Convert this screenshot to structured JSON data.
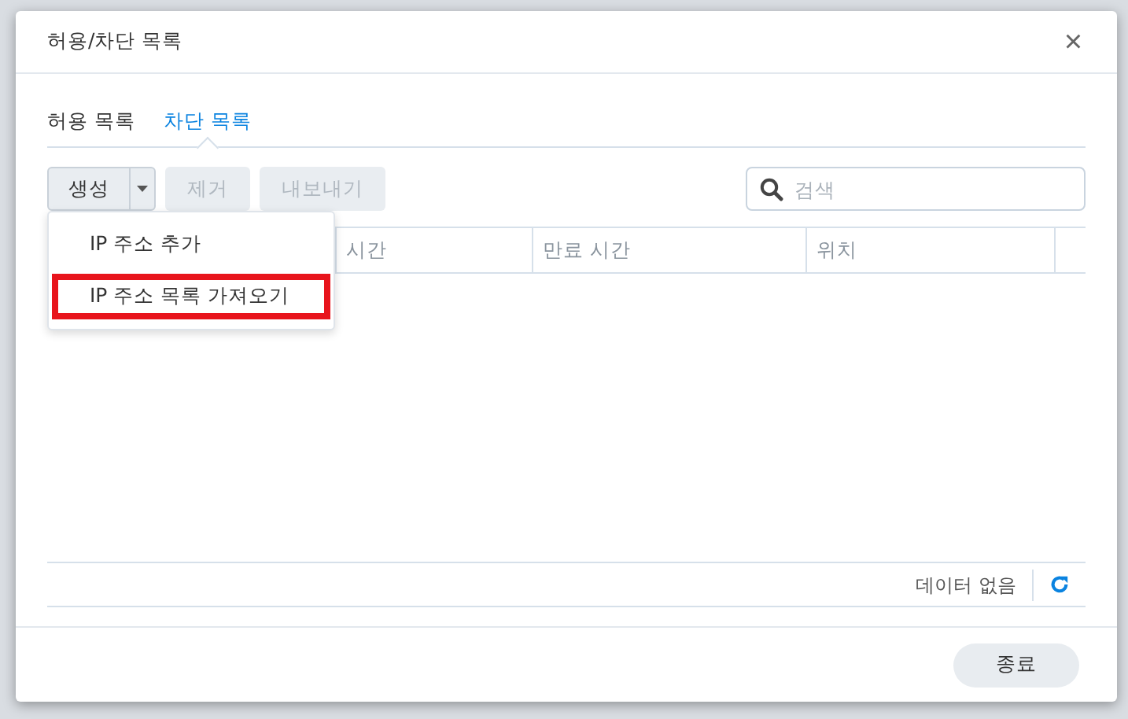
{
  "dialog": {
    "title": "허용/차단 목록",
    "close": "×"
  },
  "tabs": [
    {
      "label": "허용 목록",
      "selected": false
    },
    {
      "label": "차단 목록",
      "selected": true
    }
  ],
  "toolbar": {
    "create": "생성",
    "remove": {
      "label": "제거",
      "disabled": true
    },
    "export": {
      "label": "내보내기",
      "disabled": true
    }
  },
  "search": {
    "placeholder": "검색"
  },
  "menu": {
    "items": [
      {
        "label": "IP 주소 추가",
        "highlighted": false
      },
      {
        "label": "IP 주소 목록 가져오기",
        "highlighted": true
      }
    ]
  },
  "table": {
    "columns": [
      "",
      "시간",
      "만료 시간",
      "위치"
    ]
  },
  "status": "데이터 없음",
  "footer": {
    "close_button": "종료"
  }
}
